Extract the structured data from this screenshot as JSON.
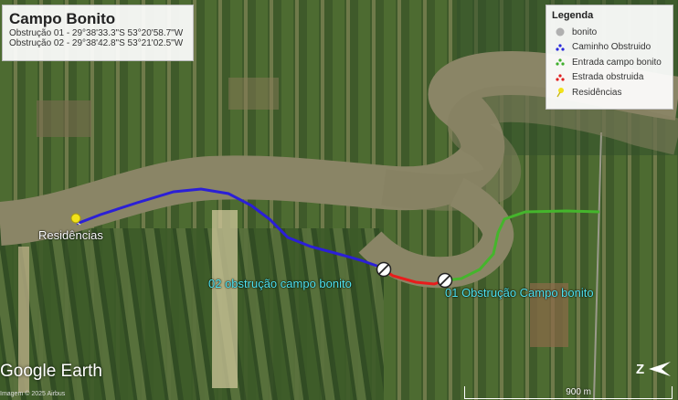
{
  "info": {
    "title": "Campo Bonito",
    "line1": "Obstrução 01 - 29°38'33.3\"S 53°20'58.7\"W",
    "line2": "Obstrução 02 - 29°38'42.8\"S 53°21'02.5\"W"
  },
  "legend": {
    "title": "Legenda",
    "items": [
      {
        "label": "bonito",
        "icon": "gray-dot-icon",
        "color": "#b0b0b0"
      },
      {
        "label": "Caminho Obstruido",
        "icon": "blue-path-icon",
        "color": "#2a2adb"
      },
      {
        "label": "Entrada campo bonito",
        "icon": "green-path-icon",
        "color": "#3fae2c"
      },
      {
        "label": "Estrada obstruida",
        "icon": "red-path-icon",
        "color": "#e02020"
      },
      {
        "label": "Residências",
        "icon": "yellow-pushpin-icon",
        "color": "#f2e21a"
      }
    ]
  },
  "labels": {
    "residencias": "Residências",
    "obstrucao02": "02 obstrução campo bonito",
    "obstrucao01": "01 Obstrução Campo bonito"
  },
  "colors": {
    "path_blue": "#2b1fd6",
    "path_red": "#e81c1c",
    "path_green": "#45b52c",
    "label_cyan": "#4fe3ef",
    "river": "#8a8566"
  },
  "brand": "Google Earth",
  "credit": "Imagem © 2025 Airbus",
  "scale": "900 m"
}
